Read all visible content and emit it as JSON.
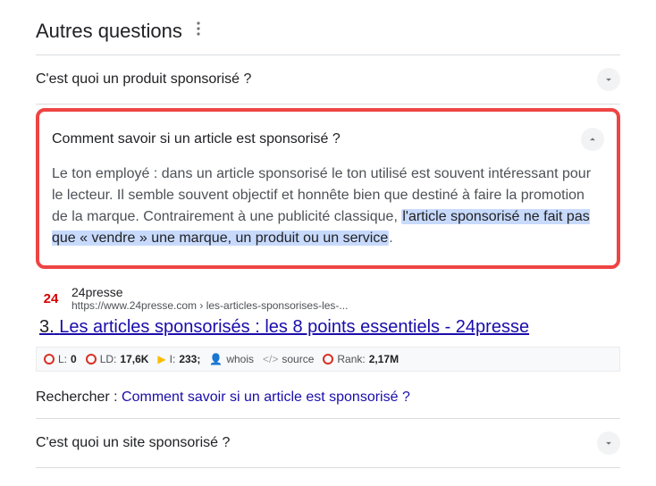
{
  "header": {
    "title": "Autres questions"
  },
  "questions": {
    "q1": "C'est quoi un produit sponsorisé ?",
    "q2": "Comment savoir si un article est sponsorisé ?",
    "q3": "C'est quoi un site sponsorisé ?"
  },
  "answer": {
    "part1": "Le ton employé : dans un article sponsorisé le ton utilisé est souvent intéressant pour le lecteur. Il semble souvent objectif et honnête bien que destiné à faire la promotion de la marque. Contrairement à une publicité classique, ",
    "highlight": "l'article sponsorisé ne fait pas que « vendre » une marque, un produit ou un service",
    "part2": "."
  },
  "source": {
    "favicon_text": "24",
    "name": "24presse",
    "url": "https://www.24presse.com › les-articles-sponsorises-les-..."
  },
  "result": {
    "num": "3.",
    "title": "Les articles sponsorisés : les 8 points essentiels - 24presse"
  },
  "seo": {
    "l_label": "L:",
    "l_val": "0",
    "ld_label": "LD:",
    "ld_val": "17,6K",
    "i_label": "I:",
    "i_val": "233;",
    "whois": "whois",
    "source": "source",
    "rank_label": "Rank:",
    "rank_val": "2,17M"
  },
  "search_for": {
    "label": "Rechercher :",
    "link": "Comment savoir si un article est sponsorisé ?"
  }
}
